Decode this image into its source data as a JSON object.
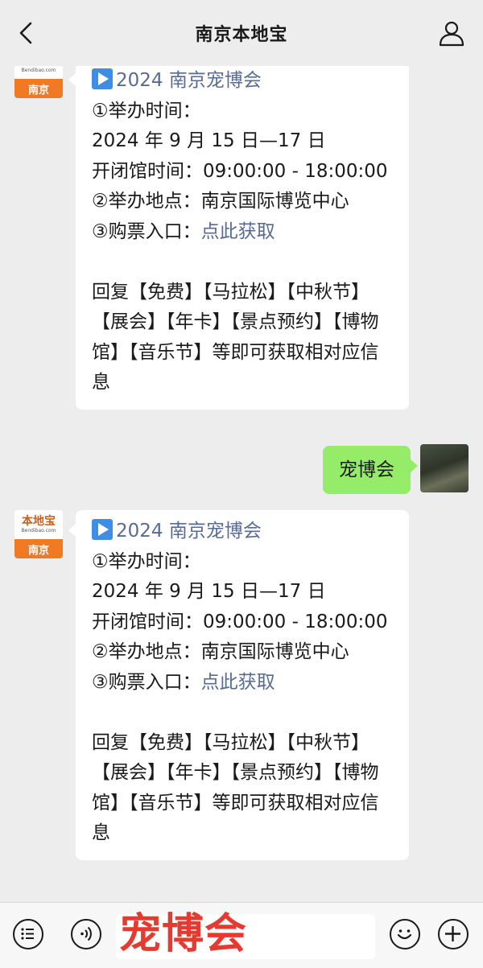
{
  "header": {
    "title": "南京本地宝"
  },
  "bot": {
    "logo_top": "本地宝",
    "logo_url": "Bendibao.com",
    "logo_city": "南京"
  },
  "messages": [
    {
      "type": "bot",
      "lines": {
        "heading": "2024 南京宠博会",
        "l1": "①举办时间：",
        "l2": "2024 年 9 月 15 日—17 日",
        "l3": "开闭馆时间：09:00:00 - 18:00:00",
        "l4_prefix": "②举办地点：",
        "l4_value": "南京国际博览中心",
        "l5_prefix": "③购票入口：",
        "l5_link": "点此获取",
        "reply": "回复【免费】【马拉松】【中秋节】【展会】【年卡】【景点预约】【博物馆】【音乐节】等即可获取相对应信息"
      }
    },
    {
      "type": "user",
      "text": "宠博会"
    },
    {
      "type": "bot",
      "lines": {
        "heading": "2024 南京宠博会",
        "l1": "①举办时间：",
        "l2": "2024 年 9 月 15 日—17 日",
        "l3": "开闭馆时间：09:00:00 - 18:00:00",
        "l4_prefix": "②举办地点：",
        "l4_value": "南京国际博览中心",
        "l5_prefix": "③购票入口：",
        "l5_link": "点此获取",
        "reply": "回复【免费】【马拉松】【中秋节】【展会】【年卡】【景点预约】【博物馆】【音乐节】等即可获取相对应信息"
      }
    }
  ],
  "input": {
    "value": "宠博会"
  },
  "icons": {
    "back": "chevron-left-icon",
    "profile": "person-icon",
    "menu": "list-menu-icon",
    "voice": "voice-icon",
    "emoji": "emoji-icon",
    "plus": "plus-icon"
  },
  "colors": {
    "link": "#576b95",
    "user_bubble": "#95ec69",
    "input_overlay_text": "#e53a2f",
    "logo_orange": "#f07a23",
    "play_blue": "#3f8ee6"
  }
}
